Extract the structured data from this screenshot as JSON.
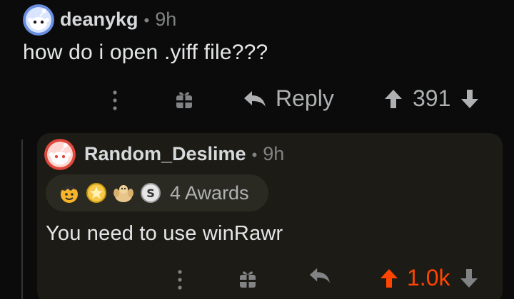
{
  "comment": {
    "author": "deanykg",
    "separator": "•",
    "time": "9h",
    "body": "how do i open .yiff file???",
    "actions": {
      "more_icon": "vertical-dots-icon",
      "gift_icon": "gift-icon",
      "reply_icon": "reply-arrow-icon",
      "reply_label": "Reply",
      "score": "391",
      "upvote_icon": "upvote-arrow-icon",
      "downvote_icon": "downvote-arrow-icon"
    }
  },
  "reply": {
    "author": "Random_Deslime",
    "separator": "•",
    "time": "9h",
    "awards": {
      "icons": [
        "wholesome-award-icon",
        "gold-award-icon",
        "strong-award-icon",
        "silver-award-icon"
      ],
      "label": "4 Awards"
    },
    "body": "You need to use winRawr",
    "actions": {
      "more_icon": "vertical-dots-icon",
      "gift_icon": "gift-icon",
      "reply_icon": "reply-arrow-icon",
      "score": "1.0k",
      "upvote_icon": "upvote-arrow-icon",
      "downvote_icon": "downvote-arrow-icon"
    }
  },
  "colors": {
    "background": "#0b0b0b",
    "card": "#1c1b15",
    "upvote_active": "#ff4500",
    "muted": "#818384"
  }
}
